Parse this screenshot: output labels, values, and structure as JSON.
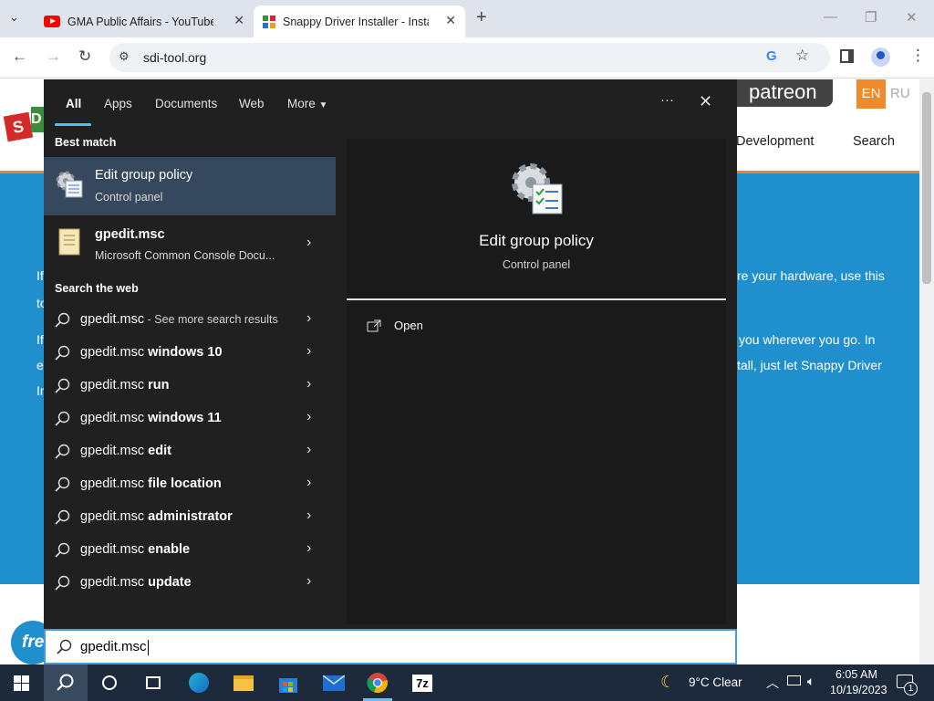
{
  "browser": {
    "tabs": [
      {
        "label": "GMA Public Affairs - YouTube"
      },
      {
        "label": "Snappy Driver Installer - Install"
      }
    ],
    "new_tab_label": "+",
    "url": "sdi-tool.org"
  },
  "site": {
    "patreon_label": "patreon",
    "lang_en": "EN",
    "lang_ru": "RU",
    "nav_development": "Development",
    "nav_search": "Search",
    "hero_lines": [
      "re your hardware, use this",
      "you wherever you go. In",
      "tall, just let Snappy Driver"
    ],
    "hero_left": [
      "If",
      "to",
      "If",
      "e",
      "In"
    ],
    "free_badge": "fre"
  },
  "search": {
    "tabs": [
      "All",
      "Apps",
      "Documents",
      "Web",
      "More"
    ],
    "options_label": "···",
    "close_label": "✕",
    "best_match_heading": "Best match",
    "best_match": {
      "title": "Edit group policy",
      "subtitle": "Control panel"
    },
    "other_app": {
      "title": "gpedit.msc",
      "subtitle": "Microsoft Common Console Docu..."
    },
    "web_heading": "Search the web",
    "web_results": [
      {
        "base": "gpedit.msc",
        "suffix": "",
        "extra": " - See more search results"
      },
      {
        "base": "gpedit.msc",
        "suffix": " windows 10",
        "extra": ""
      },
      {
        "base": "gpedit.msc",
        "suffix": " run",
        "extra": ""
      },
      {
        "base": "gpedit.msc",
        "suffix": " windows 11",
        "extra": ""
      },
      {
        "base": "gpedit.msc",
        "suffix": " edit",
        "extra": ""
      },
      {
        "base": "gpedit.msc",
        "suffix": " file location",
        "extra": ""
      },
      {
        "base": "gpedit.msc",
        "suffix": " administrator",
        "extra": ""
      },
      {
        "base": "gpedit.msc",
        "suffix": " enable",
        "extra": ""
      },
      {
        "base": "gpedit.msc",
        "suffix": " update",
        "extra": ""
      }
    ],
    "preview": {
      "title": "Edit group policy",
      "subtitle": "Control panel",
      "open_label": "Open"
    },
    "query": "gpedit.msc"
  },
  "taskbar": {
    "weather": "9°C  Clear",
    "time": "6:05 AM",
    "date": "10/19/2023",
    "notification_count": "1"
  },
  "colors": {
    "panel_bg": "#202020",
    "highlight": "#36485d",
    "accent": "#4cc2ff",
    "site_blue": "#1f8fcd",
    "site_orange": "#e7862f",
    "taskbar": "#1c2a3c"
  }
}
